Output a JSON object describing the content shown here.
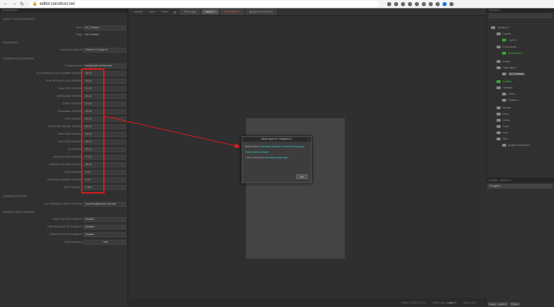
{
  "browser": {
    "url": "editor.construct.net",
    "back": "←",
    "forward": "→",
    "reload": "↻"
  },
  "left_panel": {
    "title": "PROPERTIES",
    "section_object": "OBJECT TYPE PROPERTIES",
    "section_properties": "PROPERTIES",
    "section_admob": "COMMON SETUP ANDROID",
    "section_ios": "COMMON SETUP IOS",
    "section_firebase": "FIREBASE SETUP ANDROID",
    "rows": [
      {
        "label": "Name",
        "value": "AG_Firebase"
      },
      {
        "label": "Plugin",
        "value": "AG_Firebase"
      },
      {
        "label": "Cordova CLI client ID",
        "value": "Cordova 3.0 plugin ID"
      },
      {
        "label": "Config file (path)",
        "value": "www/google-services.json"
      },
      {
        "label": "PLAY SERVICES SDK NUMBER VERSION",
        "value": "18.0.0"
      },
      {
        "label": "PLAY SERVICES AUTH VERSION",
        "value": "20.4.0"
      },
      {
        "label": "ANALYTICS VERSION",
        "value": "21.2.0"
      },
      {
        "label": "MESSAGING VERSION",
        "value": "23.1.0"
      },
      {
        "label": "CONFIG VERSION",
        "value": "21.2.0"
      },
      {
        "label": "Performance VERSION",
        "value": "20.3.0"
      },
      {
        "label": "AUTH VERSION",
        "value": "21.1.0"
      },
      {
        "label": "IN-APP MESSAGING VERSION",
        "value": "20.2.0"
      },
      {
        "label": "FIRESTORE VERSION",
        "value": "24.4.1"
      },
      {
        "label": "FUNCTIONS VERSION",
        "value": "20.2.1"
      },
      {
        "label": "IID VERSION",
        "value": "21.1.0"
      },
      {
        "label": "INSTALLATIONS VERSION",
        "value": "17.1.0"
      },
      {
        "label": "CRASHLYTICS NDK VERSION",
        "value": "18.3.2"
      },
      {
        "label": "GSON VERSION",
        "value": "2.9.0"
      },
      {
        "label": "Performance GRADLE VERSION",
        "value": "1.4.2"
      },
      {
        "label": "GSSC GRADLE'S",
        "value": "1.40.0"
      },
      {
        "label": "IOS FIREBASE CONFIG PATH/URL",
        "value": "www/GoogleService-Info.plist"
      },
      {
        "label": "ANALYTICS SET ENABLED",
        "value": "Disabled"
      },
      {
        "label": "PERFORMANCE SET ENABLED",
        "value": "Disabled"
      },
      {
        "label": "CRASHLYTICS SET ENABLED",
        "value": "Disabled"
      },
      {
        "label": "More information",
        "value": "Help"
      }
    ]
  },
  "toolbar": {
    "items": [
      "Layouts",
      "Undo",
      "Redo"
    ],
    "tabs": [
      "Start page",
      "Layout 1",
      "Event sheet 1",
      "google-services.json"
    ]
  },
  "dialog": {
    "title": "Build report for 'Analytics 3'",
    "close": "×",
    "line1": "Build finished!",
    "line1_link": "Download Analytics 3 (android debug.apk)",
    "line2_link": "Open project manager",
    "line3": "Learn more about",
    "line3_link": "publishing mobile apps",
    "ok": "OK"
  },
  "right_panel": {
    "title": "PROJECT",
    "tree": [
      "Analytics 3*",
      "Layouts",
      "Layout 1",
      "Event sheets",
      "Event sheet 1",
      "Scripts",
      "Object types",
      "AG_Firebase",
      "Families",
      "Timelines",
      "Tween",
      "Timeline 1",
      "Sounds",
      "Music",
      "Videos",
      "Fonts",
      "Icons",
      "Files",
      "google-services.json"
    ]
  },
  "layers": {
    "title": "LAYERS - LAYOUT 1",
    "items": [
      "Layer 0"
    ]
  },
  "bottom_tabs": [
    "Layers - Layout 1",
    "Project"
  ],
  "status": {
    "mouse": "Mouse: (1120, 1172)",
    "active_layer_label": "Active layer:",
    "active_layer": "Layer 0",
    "zoom": "Zoom: 49%"
  },
  "colors": {
    "annotation_red": "#e01919",
    "link": "#3bc4c4",
    "success_green": "#44cc44"
  }
}
